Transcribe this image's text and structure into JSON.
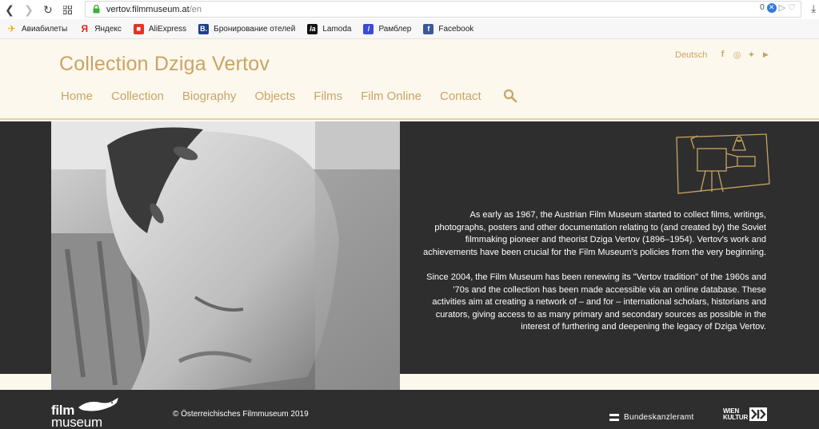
{
  "browser": {
    "url_domain": "vertov.filmmuseum.at",
    "url_path": "/en",
    "ad_count": "0",
    "block_badge": "✕"
  },
  "bookmarks": [
    {
      "label": "Авиабилеты",
      "icon": "plane-icon",
      "color": "#f2a900"
    },
    {
      "label": "Яндекс",
      "icon": "yandex-icon",
      "color": "#e52620"
    },
    {
      "label": "AliExpress",
      "icon": "aliexpress-icon",
      "color": "#e43225"
    },
    {
      "label": "Бронирование отелей",
      "icon": "booking-icon",
      "color": "#1f3f86"
    },
    {
      "label": "Lamoda",
      "icon": "lamoda-icon",
      "color": "#111111"
    },
    {
      "label": "Рамблер",
      "icon": "rambler-icon",
      "color": "#3a4bd6"
    },
    {
      "label": "Facebook",
      "icon": "facebook-icon",
      "color": "#3b5998"
    }
  ],
  "bookmark_glyphs": [
    "✈",
    "Я",
    "◼",
    "B.",
    "la",
    "/",
    "f"
  ],
  "header": {
    "title": "Collection Dziga Vertov",
    "language": "Deutsch",
    "social": [
      "facebook-icon",
      "instagram-icon",
      "twitter-icon",
      "youtube-icon"
    ],
    "social_glyphs": [
      "f",
      "◎",
      "✦",
      "▶"
    ],
    "nav": [
      "Home",
      "Collection",
      "Biography",
      "Objects",
      "Films",
      "Film Online",
      "Contact"
    ]
  },
  "hero": {
    "paragraph_1": "As early as 1967, the Austrian Film Museum started to collect films, writings, photographs, posters and other documentation relating to (and created by) the Soviet filmmaking pioneer and theorist Dziga Vertov (1896–1954). Vertov's work and achievements have been crucial for the Film Museum's policies from the very beginning.",
    "paragraph_2": "Since 2004, the Film Museum has been renewing its \"Vertov tradition\" of the 1960s and '70s and the collection has been made accessible via an online database. These activities aim at creating a network of – and for – international scholars, historians and curators, giving access to as many primary and secondary sources as possible in the interest of furthering and deepening the legacy of Dziga Vertov."
  },
  "footer": {
    "logo_line_1": "film",
    "logo_line_2": "museum",
    "copyright": "© Österreichisches Filmmuseum 2019",
    "bundeskanzleramt": "Bundeskanzleramt",
    "wien_kultur_1": "WIEN",
    "wien_kultur_2": "KULTUR"
  },
  "colors": {
    "accent": "#c9a462",
    "cream": "#fcf8ee",
    "dark": "#2e2e2e"
  }
}
